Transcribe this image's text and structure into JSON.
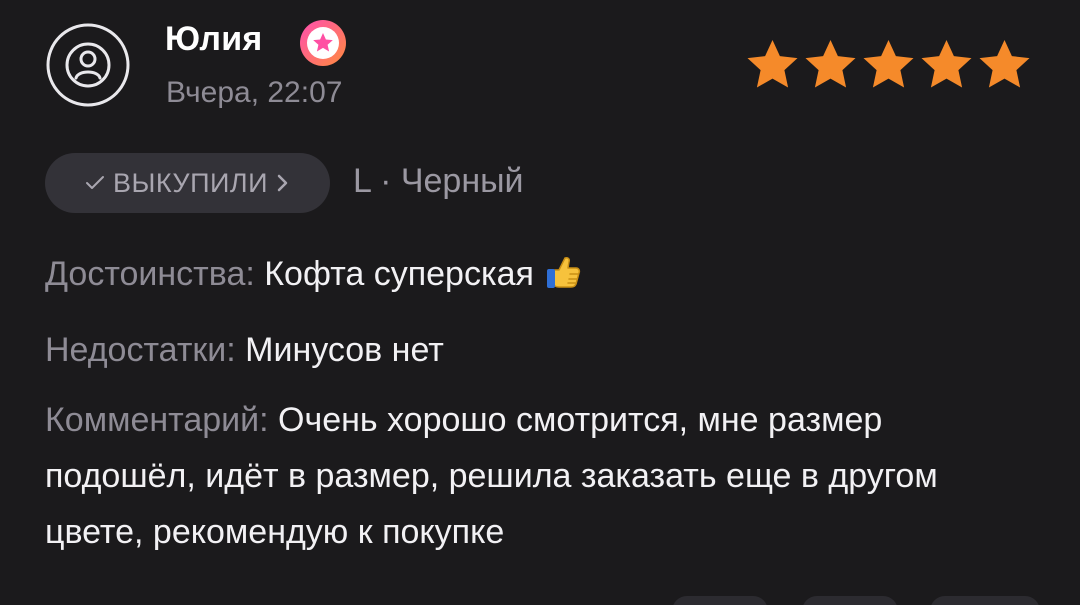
{
  "review": {
    "author": {
      "name": "Юлия",
      "badge_icon": "star-badge-icon",
      "avatar_icon": "user-avatar-icon"
    },
    "date": "Вчера, 22:07",
    "rating": {
      "value": 5,
      "max": 5,
      "color": "#f58a2a"
    },
    "purchase_tag": {
      "check_icon": "check-icon",
      "label": "ВЫКУПИЛИ",
      "chevron_icon": "chevron-right-icon"
    },
    "variant": "L · Черный",
    "pros": {
      "label": "Достоинства:",
      "text": "Кофта суперская",
      "emoji_icon": "thumbs-up-icon"
    },
    "cons": {
      "label": "Недостатки:",
      "text": "Минусов нет"
    },
    "comment": {
      "label": "Комментарий:",
      "text": "Очень хорошо смотрится, мне размер подошёл, идёт в размер, решила заказать еще в другом цвете, рекомендую к покупке"
    }
  },
  "colors": {
    "background": "#1b1a1c",
    "badge_gradient_start": "#ff5aa8",
    "badge_gradient_end": "#ff8a3d"
  }
}
